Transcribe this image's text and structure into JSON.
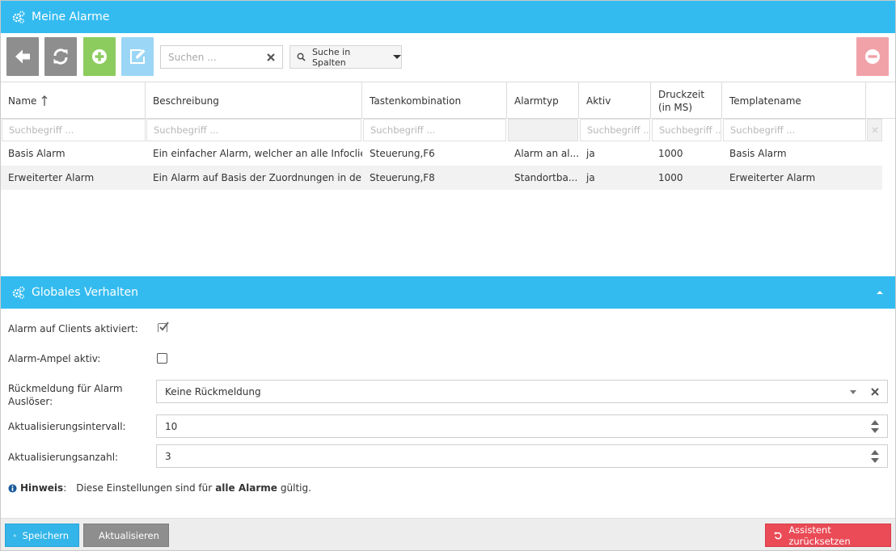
{
  "alarms_panel": {
    "title": "Meine Alarme"
  },
  "toolbar": {
    "search_placeholder": "Suchen ...",
    "column_search_label": "Suche in Spalten"
  },
  "grid": {
    "columns": [
      "Name",
      "Beschreibung",
      "Tastenkombination",
      "Alarmtyp",
      "Aktiv",
      "Druckzeit (in MS)",
      "Templatename"
    ],
    "filter_placeholder": "Suchbegriff ...",
    "rows": [
      [
        "Basis Alarm",
        "Ein einfacher Alarm, welcher an alle Infoclie...",
        "Steuerung,F6",
        "Alarm an al...",
        "ja",
        "1000",
        "Basis Alarm"
      ],
      [
        "Erweiterter Alarm",
        "Ein Alarm auf Basis der Zuordnungen in der ...",
        "Steuerung,F8",
        "Standortba...",
        "ja",
        "1000",
        "Erweiterter Alarm"
      ]
    ]
  },
  "global_panel": {
    "title": "Globales Verhalten",
    "alarm_clients_label": "Alarm auf Clients aktiviert:",
    "alarm_clients_checked": true,
    "alarm_ampel_label": "Alarm-Ampel aktiv:",
    "alarm_ampel_checked": false,
    "feedback_label_1": "Rückmeldung für Alarm",
    "feedback_label_2": "Auslöser:",
    "feedback_value": "Keine Rückmeldung",
    "interval_label": "Aktualisierungsintervall:",
    "interval_value": "10",
    "count_label": "Aktualisierungsanzahl:",
    "count_value": "3",
    "hint_label": "Hinweis",
    "hint_colon": ":",
    "hint_text_1": "Diese Einstellungen sind für",
    "hint_text_bold": "alle Alarme",
    "hint_text_2": "gültig."
  },
  "footer": {
    "save_label": "Speichern",
    "update_label": "Aktualisieren",
    "reset_label": "Assistent zurücksetzen"
  },
  "colors": {
    "header_blue": "#33bbf0",
    "add_green": "#8ccc5e",
    "remove_pink": "#f1a2a9",
    "reset_red": "#ea4b56"
  }
}
